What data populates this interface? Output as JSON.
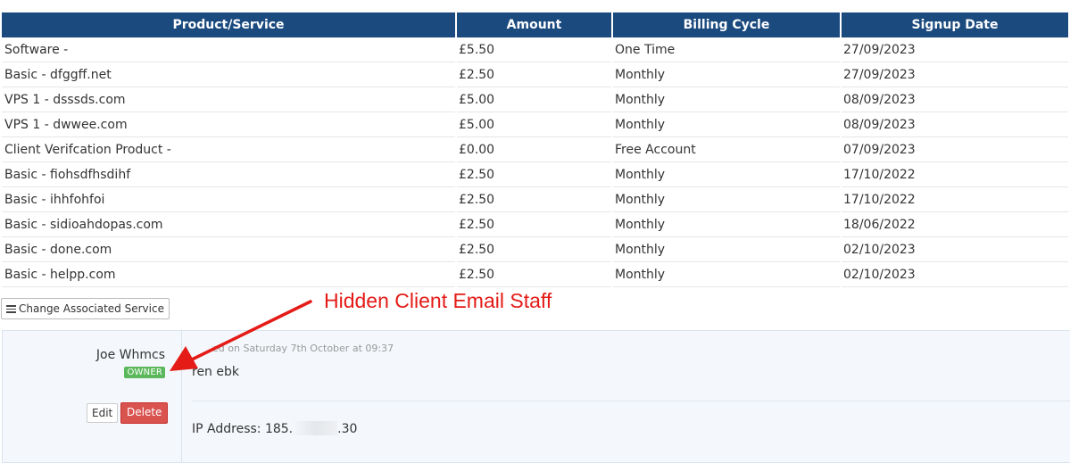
{
  "table": {
    "headers": [
      "Product/Service",
      "Amount",
      "Billing Cycle",
      "Signup Date"
    ],
    "rows": [
      {
        "product": "Software -",
        "amount": "£5.50",
        "cycle": "One Time",
        "date": "27/09/2023"
      },
      {
        "product": "Basic - dfggff.net",
        "amount": "£2.50",
        "cycle": "Monthly",
        "date": "27/09/2023"
      },
      {
        "product": "VPS 1 - dsssds.com",
        "amount": "£5.00",
        "cycle": "Monthly",
        "date": "08/09/2023"
      },
      {
        "product": "VPS 1 - dwwee.com",
        "amount": "£5.00",
        "cycle": "Monthly",
        "date": "08/09/2023"
      },
      {
        "product": "Client Verifcation Product -",
        "amount": "£0.00",
        "cycle": "Free Account",
        "date": "07/09/2023"
      },
      {
        "product": "Basic - fiohsdfhsdihf",
        "amount": "£2.50",
        "cycle": "Monthly",
        "date": "17/10/2022"
      },
      {
        "product": "Basic - ihhfohfoi",
        "amount": "£2.50",
        "cycle": "Monthly",
        "date": "17/10/2022"
      },
      {
        "product": "Basic - sidioahdopas.com",
        "amount": "£2.50",
        "cycle": "Monthly",
        "date": "18/06/2022"
      },
      {
        "product": "Basic - done.com",
        "amount": "£2.50",
        "cycle": "Monthly",
        "date": "02/10/2023"
      },
      {
        "product": "Basic - helpp.com",
        "amount": "£2.50",
        "cycle": "Monthly",
        "date": "02/10/2023"
      }
    ]
  },
  "change_service_label": "Change Associated Service",
  "annotation": "Hidden Client Email Staff",
  "note": {
    "author": "Joe Whmcs",
    "badge": "OWNER",
    "edit_label": "Edit",
    "delete_label": "Delete",
    "posted": "Posted on Saturday 7th October at 09:37",
    "body": "ren ebk",
    "ip_prefix": "IP Address: 185.",
    "ip_suffix": ".30"
  },
  "colors": {
    "header_bg": "#1b4a7f",
    "badge_green": "#5cb85c",
    "delete_red": "#d9534f",
    "annotation_red": "#e41b17"
  }
}
